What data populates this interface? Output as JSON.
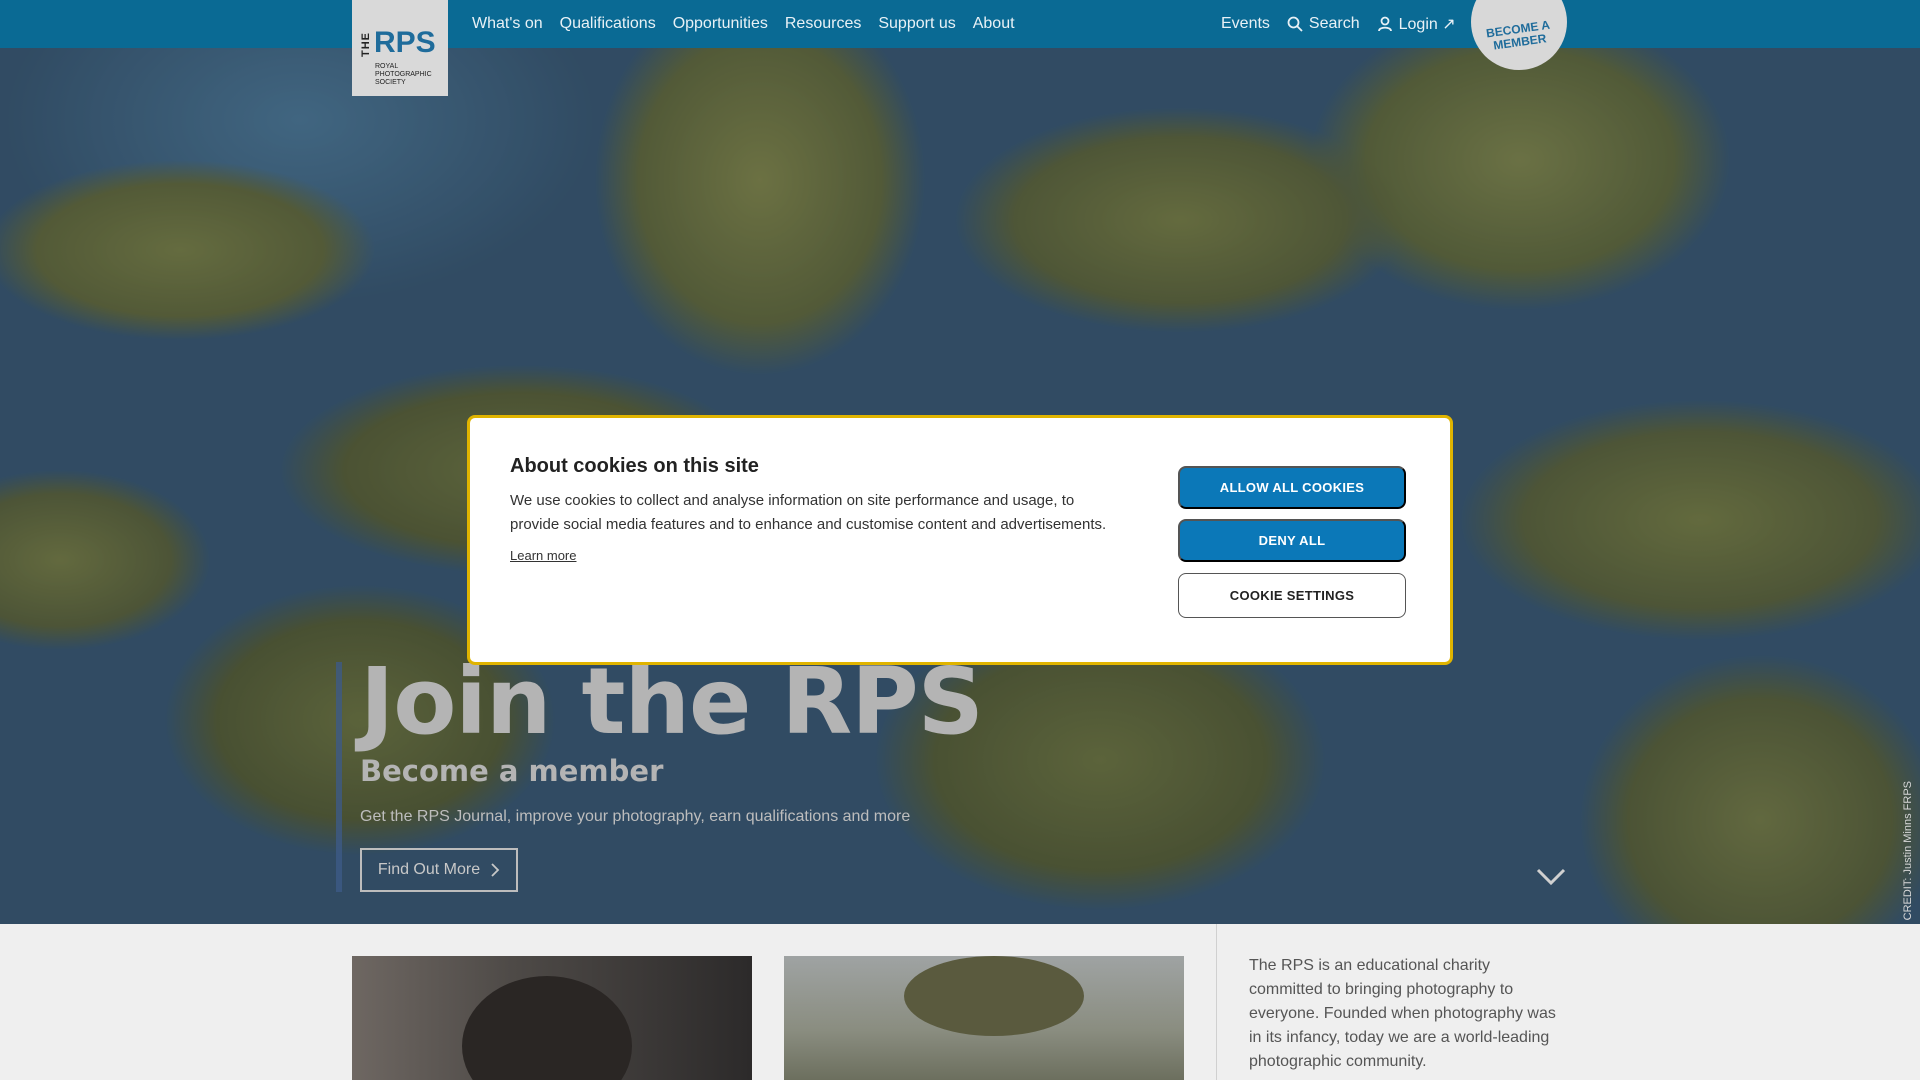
{
  "nav": {
    "logo": {
      "the": "THE",
      "rps": "RPS",
      "line1": "ROYAL",
      "line2": "PHOTOGRAPHIC",
      "line3": "SOCIETY"
    },
    "items": [
      "What's on",
      "Qualifications",
      "Opportunities",
      "Resources",
      "Support us",
      "About"
    ],
    "events": "Events",
    "search": "Search",
    "login": "Login ↗",
    "become_member": "BECOME A MEMBER",
    "color": "#0a6a94"
  },
  "hero": {
    "title": "Join the RPS",
    "subtitle": "Become a member",
    "description": "Get the RPS Journal, improve your photography, earn qualifications and more",
    "button_label": "Find Out More",
    "credit": "CREDIT: Justin Minns FRPS"
  },
  "about": {
    "text": "The RPS is an educational charity committed to bringing photography to everyone. Founded when photography was in its infancy, today we are a world-leading photographic community."
  },
  "cookie_modal": {
    "title": "About cookies on this site",
    "body": "We use cookies to collect and analyse information on site performance and usage, to provide social media features and to enhance and customise content and advertisements.",
    "learn_more": "Learn more",
    "allow_all": "ALLOW ALL COOKIES",
    "deny_all": "DENY ALL",
    "settings": "COOKIE SETTINGS",
    "accent": "#0b78b8",
    "border": "#e0b400"
  }
}
